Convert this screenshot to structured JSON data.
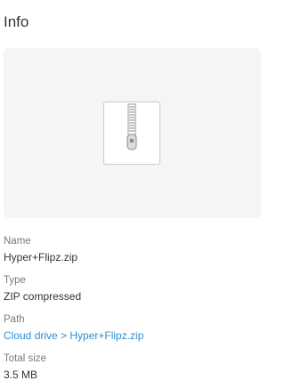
{
  "panel": {
    "title": "Info"
  },
  "preview": {
    "icon": "zip-archive-icon"
  },
  "fields": {
    "name": {
      "label": "Name",
      "value": "Hyper+Flipz.zip"
    },
    "type": {
      "label": "Type",
      "value": "ZIP compressed"
    },
    "path": {
      "label": "Path",
      "value": "Cloud drive > Hyper+Flipz.zip"
    },
    "size": {
      "label": "Total size",
      "value": "3.5 MB"
    }
  },
  "colors": {
    "link": "#2e8fd1",
    "label": "#7a7a7a",
    "text": "#333333",
    "preview_bg": "#f5f5f5"
  }
}
